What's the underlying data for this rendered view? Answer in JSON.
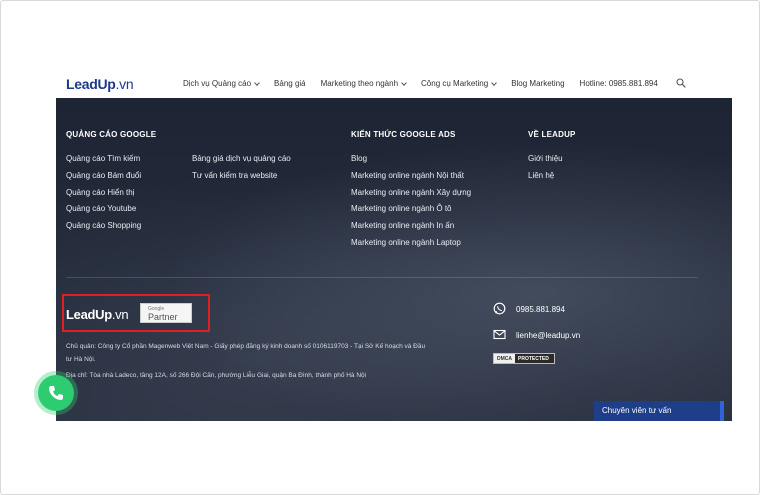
{
  "header": {
    "logo_text": "LeadUp",
    "logo_suffix": ".vn",
    "nav": [
      {
        "label": "Dịch vụ Quảng cáo",
        "dropdown": true
      },
      {
        "label": "Bảng giá",
        "dropdown": false
      },
      {
        "label": "Marketing theo ngành",
        "dropdown": true
      },
      {
        "label": "Công cụ Marketing",
        "dropdown": true
      },
      {
        "label": "Blog Marketing",
        "dropdown": false
      },
      {
        "label": "Hotline: 0985.881.894",
        "dropdown": false
      }
    ],
    "search_icon": "search-icon"
  },
  "footer": {
    "col1": {
      "title": "QUẢNG CÁO GOOGLE",
      "items": [
        "Quảng cáo Tìm kiếm",
        "Quảng cáo Bám đuổi",
        "Quảng cáo Hiển thị",
        "Quảng cáo Youtube",
        "Quảng cáo Shopping"
      ]
    },
    "col2": {
      "items": [
        "Bảng giá dịch vụ quảng cáo",
        "Tư vấn kiểm tra website"
      ]
    },
    "col3": {
      "title": "KIẾN THỨC GOOGLE ADS",
      "items": [
        "Blog",
        "Marketing online ngành Nội thất",
        "Marketing online ngành Xây dựng",
        "Marketing online ngành Ô tô",
        "Marketing online ngành In ấn",
        "Marketing online ngành Laptop"
      ]
    },
    "col4": {
      "title": "VỀ LEADUP",
      "items": [
        "Giới thiệu",
        "Liên hệ"
      ]
    },
    "brand": {
      "logo_text": "LeadUp",
      "logo_suffix": ".vn",
      "partner_top": "Google",
      "partner_bottom": "Partner"
    },
    "legal": {
      "owner": "Chủ quản: Công ty Cổ phần Magenweb Việt Nam - Giấy phép đăng ký kinh doanh số 0106119703 - Tại Sở Kế hoạch và Đầu tư Hà Nội.",
      "address": "Địa chỉ: Tòa nhà Ladeco, tầng 12A, số 266 Đội Cấn, phường Liễu Giai, quận Ba Đình, thành phố Hà Nội"
    },
    "contact": {
      "phone": "0985.881.894",
      "email": "lienhe@leadup.vn",
      "badge_left": "DMCA",
      "badge_right": "PROTECTED"
    }
  },
  "chat_button": "Chuyên viên tư vấn",
  "colors": {
    "brand": "#1a3a8a",
    "accent_green": "#2ecc71",
    "footer_bg": "#1d2433",
    "highlight": "#e02020"
  }
}
